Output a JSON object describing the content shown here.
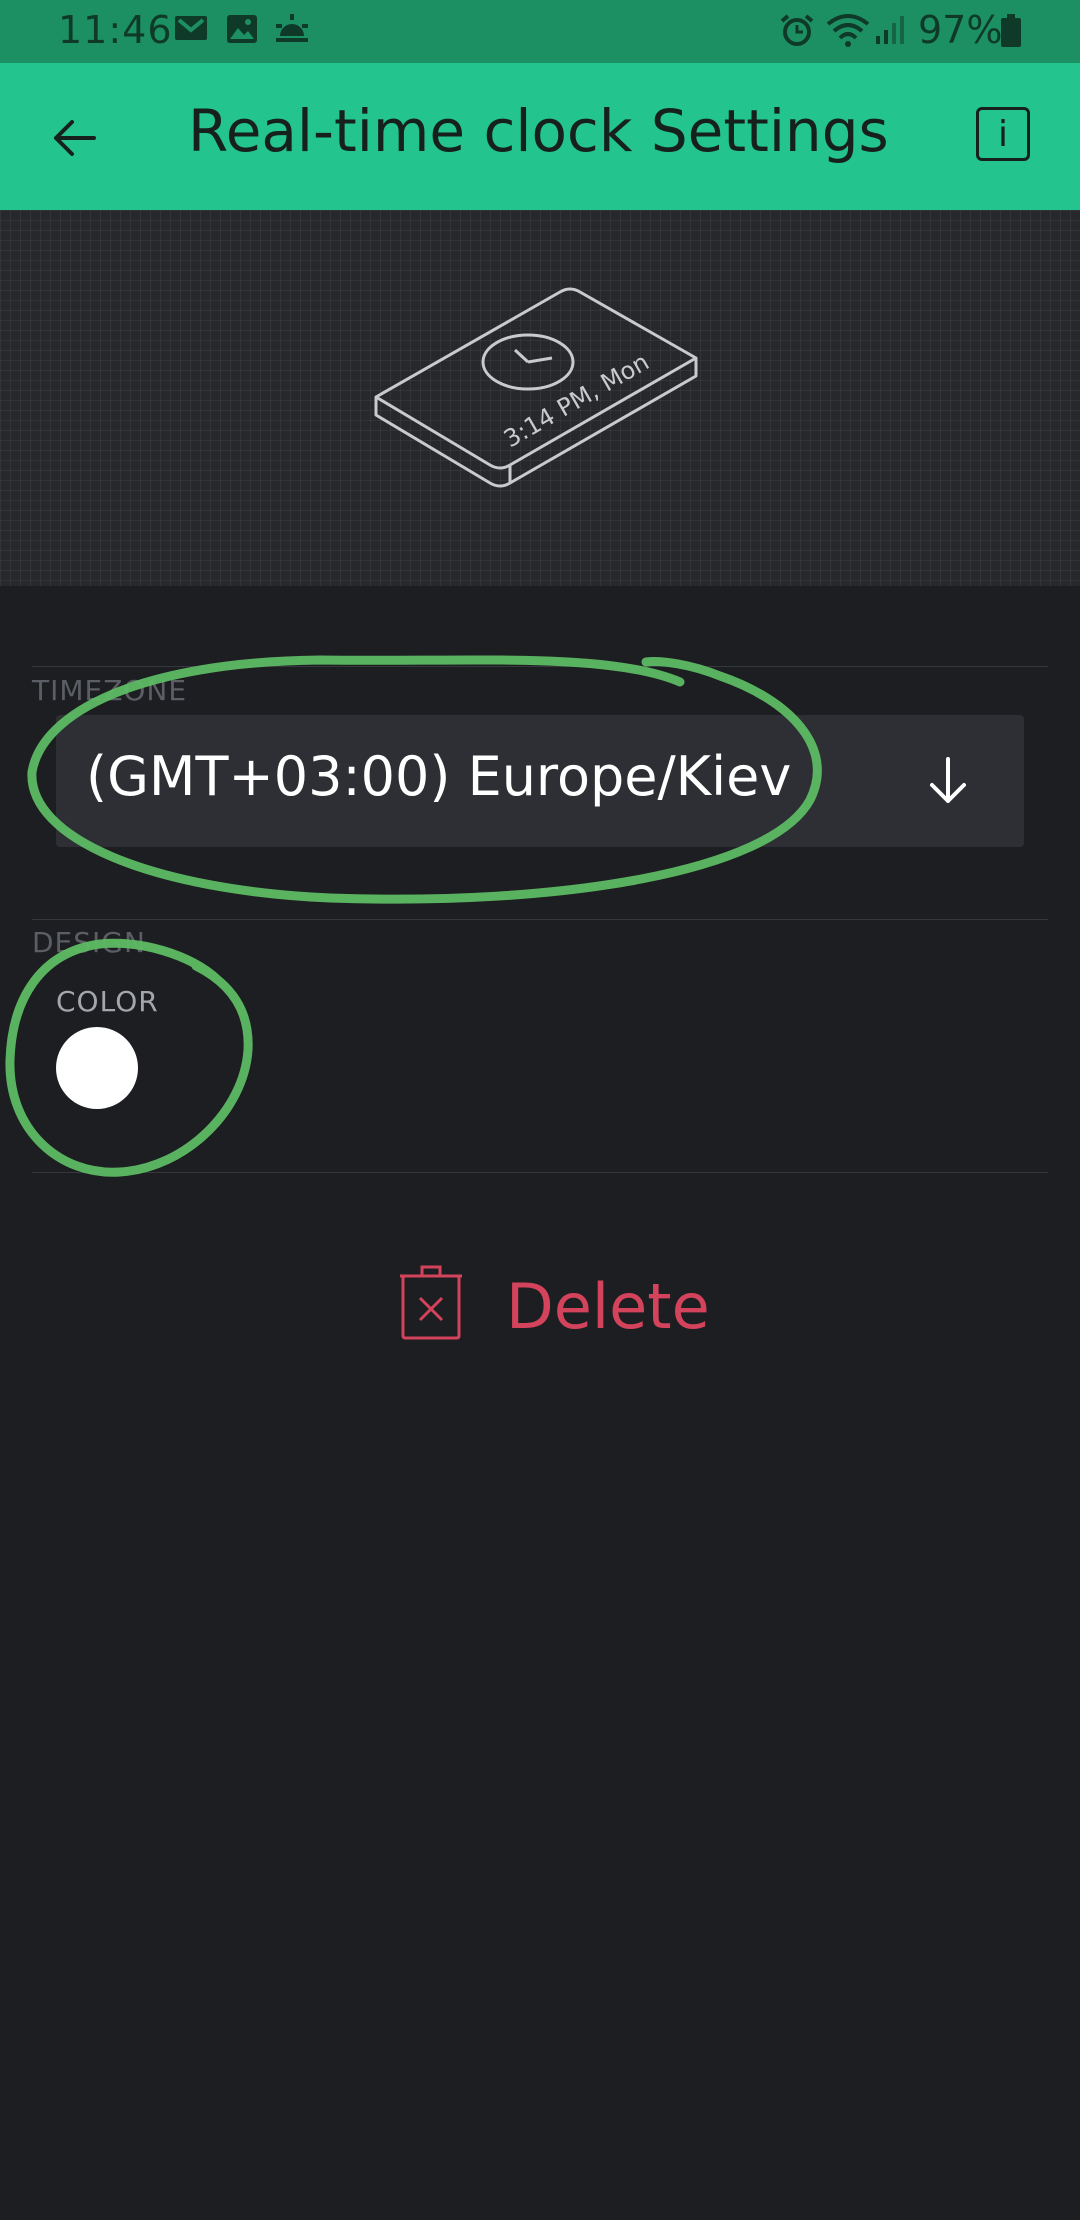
{
  "status_bar": {
    "time": "11:46",
    "battery": "97%",
    "icons": [
      "gmail-icon",
      "gallery-icon",
      "weather-icon",
      "alarm-icon",
      "wifi-icon",
      "signal-icon",
      "battery-icon"
    ]
  },
  "app_bar": {
    "title": "Real-time clock Settings",
    "back_icon": "back-arrow-icon",
    "info_label": "i"
  },
  "preview": {
    "display_text": "3:14 PM, Mon"
  },
  "timezone": {
    "section_label": "TIMEZONE",
    "value": "(GMT+03:00) Europe/Kiev",
    "dropdown_icon": "arrow-down-icon"
  },
  "design": {
    "section_label": "DESIGN",
    "color_label": "COLOR",
    "color_value": "#ffffff"
  },
  "delete": {
    "label": "Delete",
    "icon": "trash-icon"
  },
  "colors": {
    "accent": "#23c48e",
    "status_bar": "#1c8f63",
    "background": "#1d1e22",
    "danger": "#d3435c",
    "annotation": "#5dbb63"
  }
}
